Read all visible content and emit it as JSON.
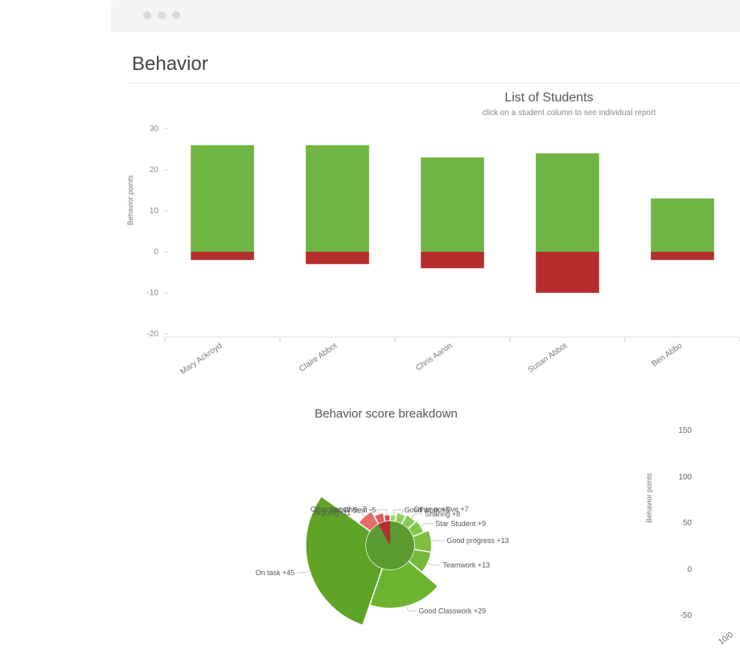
{
  "title": "Behavior",
  "chart_data": [
    {
      "type": "bar",
      "title": "List of Students",
      "subtitle": "click on a student column to see individual report",
      "ylabel": "Behavior points",
      "ylim": [
        -20,
        30
      ],
      "yticks": [
        -20,
        -10,
        0,
        10,
        20,
        30
      ],
      "categories": [
        "Mary Ackroyd",
        "Claire Abbot",
        "Chris Aaron",
        "Susan Abbot",
        "Ben Abbo"
      ],
      "series": [
        {
          "name": "positive",
          "color": "#6eb543",
          "values": [
            26,
            26,
            23,
            24,
            13
          ]
        },
        {
          "name": "negative",
          "color": "#b52e2e",
          "values": [
            -2,
            -3,
            -4,
            -10,
            -2
          ]
        }
      ]
    },
    {
      "type": "pie",
      "title": "Behavior score breakdown",
      "slices": [
        {
          "label": "Good work",
          "value": 5,
          "color": "#9cd66a",
          "sign": "+"
        },
        {
          "label": "Other positive",
          "value": 7,
          "color": "#94d05f",
          "sign": "+"
        },
        {
          "label": "Sharing",
          "value": 8,
          "color": "#8ccb55",
          "sign": "+"
        },
        {
          "label": "Star Student",
          "value": 9,
          "color": "#84c54b",
          "sign": "+"
        },
        {
          "label": "Good progress",
          "value": 13,
          "color": "#7cbf41",
          "sign": "+"
        },
        {
          "label": "Teamwork",
          "value": 13,
          "color": "#74b938",
          "sign": "+"
        },
        {
          "label": "Good Classwork",
          "value": 29,
          "color": "#6cb42f",
          "sign": "+"
        },
        {
          "label": "On task",
          "value": 45,
          "color": "#5fa327",
          "sign": "+"
        },
        {
          "label": "Arguing",
          "value": 11,
          "color": "#e76d6d",
          "sign": "-"
        },
        {
          "label": "Other negative",
          "value": 7,
          "color": "#e15c5c",
          "sign": "-"
        },
        {
          "label": "Out Of Seat",
          "value": 5,
          "color": "#d94a4a",
          "sign": "-"
        }
      ]
    },
    {
      "type": "line",
      "ylabel": "Behavior points",
      "ylim": [
        -50,
        150
      ],
      "yticks": [
        -50,
        0,
        50,
        100,
        150
      ],
      "xlabels": [
        "10/0"
      ]
    }
  ]
}
